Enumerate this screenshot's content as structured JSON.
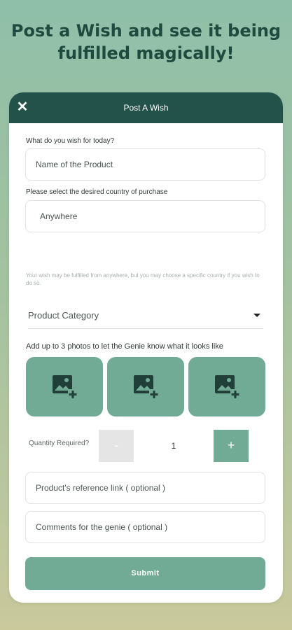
{
  "headline": {
    "line1": "Post a Wish and see it being",
    "line2": "fulfilled magically!"
  },
  "header": {
    "title": "Post A Wish",
    "close_icon": "close-icon"
  },
  "form": {
    "wish_label": "What do you wish for today?",
    "product_placeholder": "Name of the Product",
    "country_label": "Please select the desired country of purchase",
    "country_value": "Anywhere",
    "country_hint": "Your wish may be fulfilled from anywhere, but you may choose a specific country if you wish to do so.",
    "category_placeholder": "Product Category",
    "photos_label": "Add up to 3 photos to let the Genie know what it looks like",
    "photo_icon": "add-photo-icon",
    "quantity_label": "Quantity Required?",
    "quantity_minus": "-",
    "quantity_value": "1",
    "quantity_plus": "+",
    "reference_placeholder": "Product's reference link ( optional )",
    "comments_placeholder": "Comments for the genie ( optional )",
    "submit_label": "Submit"
  },
  "colors": {
    "header_bg": "#23524a",
    "accent": "#71ab95",
    "headline_text": "#1e4a3f"
  }
}
